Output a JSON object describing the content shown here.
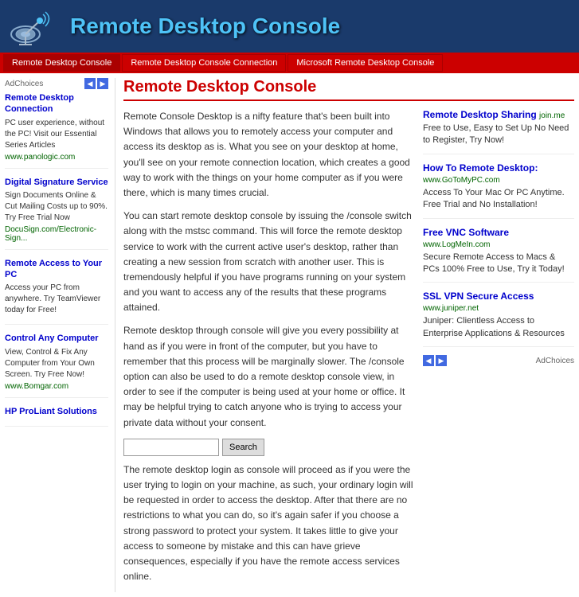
{
  "header": {
    "title": "Remote Desktop Console"
  },
  "nav": {
    "items": [
      {
        "label": "Remote Desktop Console",
        "active": true
      },
      {
        "label": "Remote Desktop Console Connection",
        "active": false
      },
      {
        "label": "Microsoft Remote Desktop Console",
        "active": false
      }
    ]
  },
  "sidebar": {
    "ad_choices_label": "AdChoices",
    "ads": [
      {
        "title": "Remote Desktop Connection",
        "text": "PC user experience, without the PC! Visit our Essential Series Articles",
        "url": "www.panologic.com"
      },
      {
        "title": "Digital Signature Service",
        "text": "Sign Documents Online & Cut Mailing Costs up to 90%. Try Free Trial Now",
        "url": "DocuSign.com/Electronic-Sign..."
      },
      {
        "title": "Remote Access to Your PC",
        "text": "Access your PC from anywhere. Try TeamViewer today for Free!",
        "url": ""
      },
      {
        "title": "Control Any Computer",
        "text": "View, Control & Fix Any Computer from Your Own Screen. Try Free Now!",
        "url": "www.Bomgar.com"
      },
      {
        "title": "HP ProLiant Solutions",
        "text": "",
        "url": ""
      }
    ]
  },
  "content": {
    "title": "Remote Desktop Console",
    "paragraphs": [
      "Remote Console Desktop is a nifty feature that's been built into Windows that allows you to remotely access your computer and access its desktop as is. What you see on your desktop at home, you'll see on your remote connection location, which creates a good way to work with the things on your home computer as if you were there, which is many times crucial.",
      "You can start remote desktop console by issuing the /console switch along with the mstsc command. This will force the remote desktop service to work with the current active user's desktop, rather than creating a new session from scratch with another user. This is tremendously helpful if you have programs running on your system and you want to access any of the results that these programs attained.",
      "Remote desktop through console will give you every possibility at hand as if you were in front of the computer, but you have to remember that this process will be marginally slower. The /console option can also be used to do a remote desktop console view, in order to see if the computer is being used at your home or office. It may be helpful trying to catch anyone who is trying to access your private data without your consent.",
      "The remote desktop login as console will proceed as if you were the user trying to login on your machine, as such, your ordinary login will be requested in order to access the desktop. After that there are no restrictions to what you can do, so it's again safer if you choose a strong password to protect your system. It takes little to give your access to someone by mistake and this can have grieve consequences, especially if you have the remote access services online."
    ]
  },
  "right_ads": {
    "ads": [
      {
        "title": "Remote Desktop Sharing",
        "domain": "join.me",
        "text": "Free to Use, Easy to Set Up No Need to Register, Try Now!"
      },
      {
        "title": "How To Remote Desktop:",
        "domain": "www.GoToMyPC.com",
        "text": "Access To Your Mac Or PC Anytime. Free Trial and No Installation!"
      },
      {
        "title": "Free VNC Software",
        "domain": "www.LogMeIn.com",
        "text": "Secure Remote Access to Macs & PCs 100% Free to Use, Try it Today!"
      },
      {
        "title": "SSL VPN Secure Access",
        "domain": "www.juniper.net",
        "text": "Juniper: Clientless Access to Enterprise Applications & Resources"
      }
    ],
    "ad_choices_label": "AdChoices"
  },
  "bottom": {
    "input_placeholder": "",
    "button_label": "Search"
  }
}
